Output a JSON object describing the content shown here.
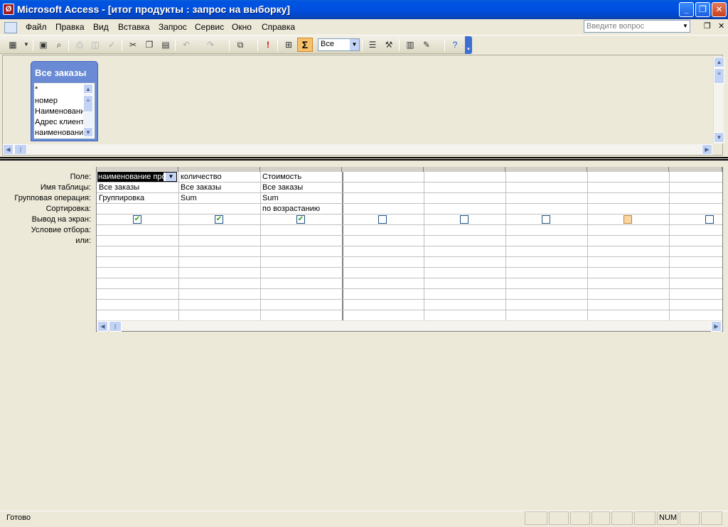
{
  "window": {
    "title": "Microsoft Access - [итог продукты : запрос на выборку]",
    "app_icon_glyph": "Ø",
    "minimize_glyph": "_",
    "restore_glyph": "❐",
    "close_glyph": "✕"
  },
  "menu": {
    "items": [
      {
        "label": "Файл"
      },
      {
        "label": "Правка"
      },
      {
        "label": "Вид"
      },
      {
        "label": "Вставка"
      },
      {
        "label": "Запрос"
      },
      {
        "label": "Сервис"
      },
      {
        "label": "Окно"
      },
      {
        "label": "Справка"
      }
    ],
    "ask_placeholder": "Введите вопрос",
    "doc_restore_glyph": "❐",
    "doc_close_glyph": "✕"
  },
  "toolbar": {
    "sigma_label": "Σ",
    "top_values": "Все",
    "icons": [
      "view-icon",
      "save-icon",
      "search-icon",
      "print-icon",
      "print-preview-icon",
      "spelling-icon",
      "cut-icon",
      "copy-icon",
      "paste-icon",
      "undo-icon",
      "redo-icon",
      "query-type-icon",
      "run-icon",
      "show-table-icon",
      "totals-icon",
      "properties-icon",
      "build-icon",
      "database-window-icon",
      "new-object-icon",
      "help-icon"
    ]
  },
  "table_box": {
    "title": "Все заказы",
    "fields": [
      "*",
      "номер",
      "Наименование",
      "Адрес клиента",
      "наименование"
    ]
  },
  "grid": {
    "row_labels": [
      "Поле:",
      "Имя таблицы:",
      "Групповая операция:",
      "Сортировка:",
      "Вывод на экран:",
      "Условие отбора:",
      "или:"
    ],
    "columns": [
      {
        "field": "наименование про",
        "table": "Все заказы",
        "group": "Группировка",
        "sort": "",
        "show": true
      },
      {
        "field": "количество",
        "table": "Все заказы",
        "group": "Sum",
        "sort": "",
        "show": true
      },
      {
        "field": "Стоимость",
        "table": "Все заказы",
        "group": "Sum",
        "sort": "по возрастанию",
        "show": true
      },
      {
        "field": "",
        "table": "",
        "group": "",
        "sort": "",
        "show": false
      },
      {
        "field": "",
        "table": "",
        "group": "",
        "sort": "",
        "show": false
      },
      {
        "field": "",
        "table": "",
        "group": "",
        "sort": "",
        "show": false
      },
      {
        "field": "",
        "table": "",
        "group": "",
        "sort": "",
        "show": false
      },
      {
        "field": "",
        "table": "",
        "group": "",
        "sort": "",
        "show": false
      }
    ]
  },
  "status": {
    "text": "Готово",
    "numlock": "NUM"
  }
}
